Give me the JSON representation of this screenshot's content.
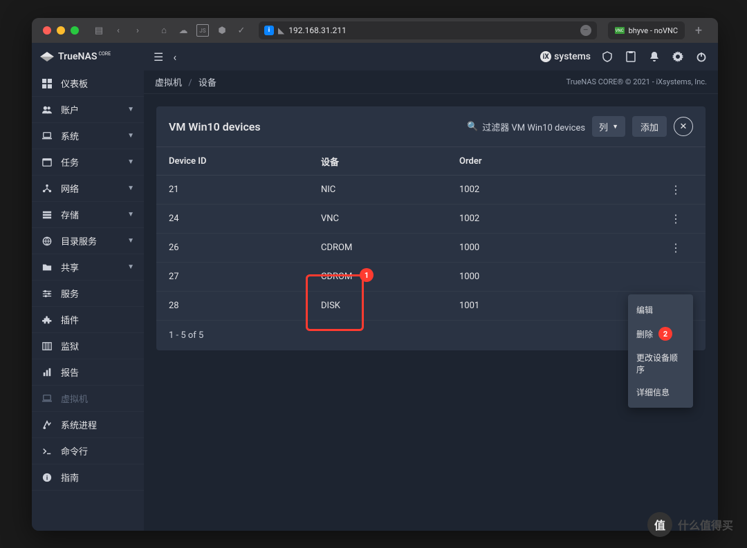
{
  "browser": {
    "address": "192.168.31.211",
    "tab2": "bhyve - noVNC"
  },
  "brand": "TrueNAS",
  "brand_sub": "CORE",
  "nav": [
    {
      "label": "仪表板",
      "expand": false
    },
    {
      "label": "账户",
      "expand": true
    },
    {
      "label": "系统",
      "expand": true
    },
    {
      "label": "任务",
      "expand": true
    },
    {
      "label": "网络",
      "expand": true
    },
    {
      "label": "存储",
      "expand": true
    },
    {
      "label": "目录服务",
      "expand": true
    },
    {
      "label": "共享",
      "expand": true
    },
    {
      "label": "服务",
      "expand": false
    },
    {
      "label": "插件",
      "expand": false
    },
    {
      "label": "监狱",
      "expand": false
    },
    {
      "label": "报告",
      "expand": false
    },
    {
      "label": "虚拟机",
      "expand": false,
      "active": true
    },
    {
      "label": "系统进程",
      "expand": false
    },
    {
      "label": "命令行",
      "expand": false
    },
    {
      "label": "指南",
      "expand": false
    }
  ],
  "breadcrumb": {
    "a": "虚拟机",
    "sep": "/",
    "b": "设备"
  },
  "copyright": "TrueNAS CORE® © 2021 - iXsystems, Inc.",
  "ixsystems": "systems",
  "panel": {
    "title": "VM Win10 devices",
    "search_placeholder": "过滤器 VM Win10 devices",
    "col_label": "列",
    "add_label": "添加"
  },
  "columns": {
    "id": "Device ID",
    "device": "设备",
    "order": "Order"
  },
  "rows": [
    {
      "id": "21",
      "device": "NIC",
      "order": "1002"
    },
    {
      "id": "24",
      "device": "VNC",
      "order": "1002"
    },
    {
      "id": "26",
      "device": "CDROM",
      "order": "1000"
    },
    {
      "id": "27",
      "device": "CDROM",
      "order": "1000"
    },
    {
      "id": "28",
      "device": "DISK",
      "order": "1001"
    }
  ],
  "pager": "1 - 5 of 5",
  "menu": {
    "edit": "编辑",
    "delete": "删除",
    "reorder": "更改设备顺序",
    "details": "详细信息"
  },
  "annot": {
    "n1": "1",
    "n2": "2"
  },
  "watermark": {
    "icon": "值",
    "text": "什么值得买"
  }
}
